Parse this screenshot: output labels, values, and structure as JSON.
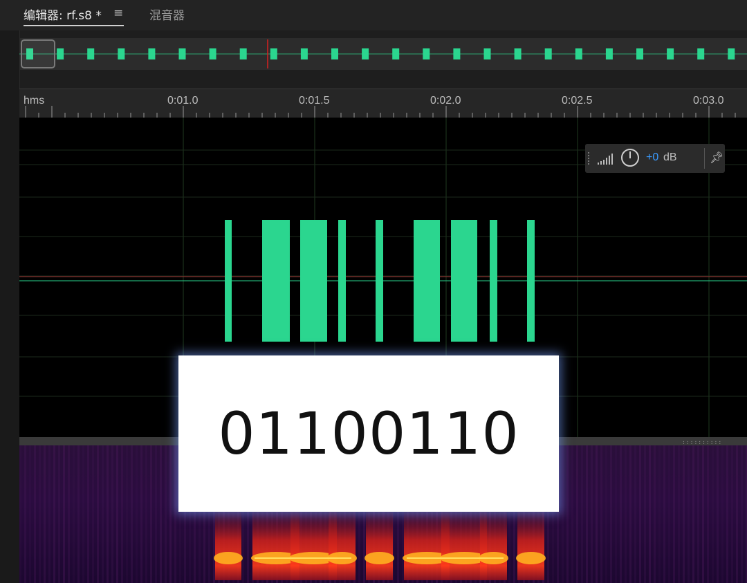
{
  "tabs": {
    "editor_label": "编辑器: rf.s8 *",
    "menu_icon": "≡",
    "mixer_label": "混音器"
  },
  "ruler": {
    "unit_label": "hms",
    "labels": [
      "0:01.0",
      "0:01.5",
      "0:02.0",
      "0:02.5",
      "0:03.0"
    ]
  },
  "gain_hud": {
    "value": "+0",
    "unit": "dB",
    "pin_icon": "pin-icon"
  },
  "overlay": {
    "binary": "01100110"
  },
  "colors": {
    "waveform": "#2bd68f",
    "playhead": "#d62020",
    "baseline": "#c23a3a",
    "hud_value": "#3a9bff"
  }
}
